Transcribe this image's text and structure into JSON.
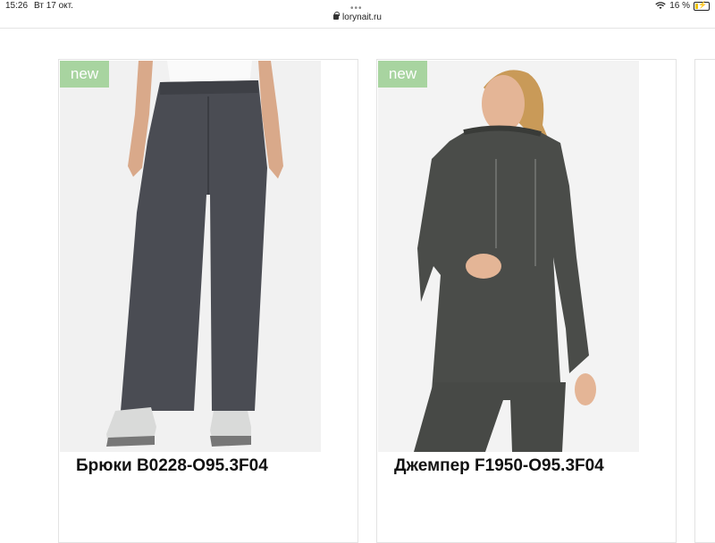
{
  "status_bar": {
    "time": "15:26",
    "date": "Вт 17 окт.",
    "battery": "16 %",
    "battery_level": 0.16
  },
  "browser": {
    "url": "lorynait.ru"
  },
  "products": [
    {
      "badge": "new",
      "title": "Брюки B0228-O95.3F04",
      "icon": "trousers-photo"
    },
    {
      "badge": "new",
      "title": "Джемпер F1950-O95.3F04",
      "icon": "hoodie-photo"
    }
  ],
  "colors": {
    "badge_bg": "#a8d4a0",
    "border": "#e3e3e3"
  }
}
